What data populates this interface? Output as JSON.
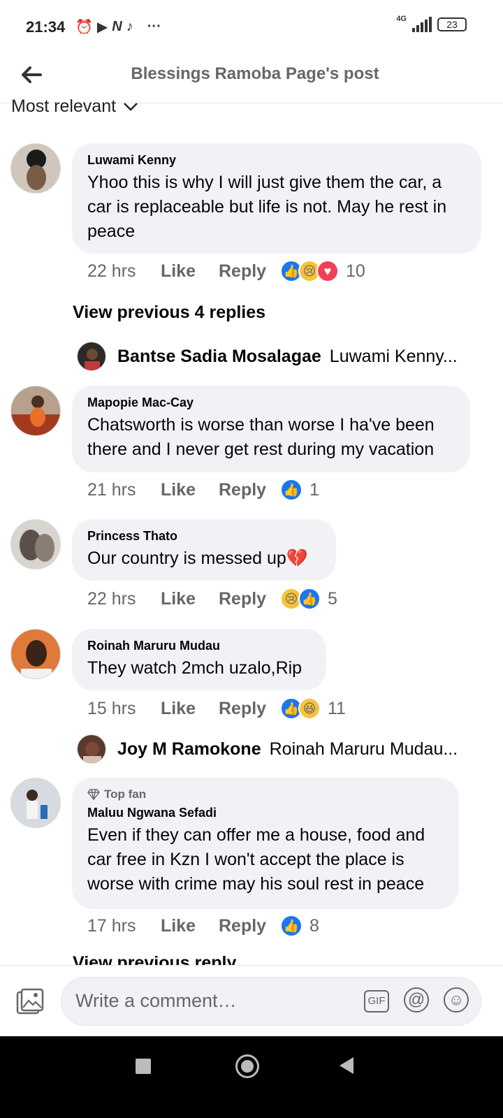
{
  "status_bar": {
    "time": "21:34",
    "network": "4G",
    "battery": "23",
    "more": "···"
  },
  "header": {
    "title": "Blessings Ramoba Page's post"
  },
  "sort": {
    "label": "Most relevant"
  },
  "comments": [
    {
      "name": "Luwami Kenny",
      "text": "Yhoo this is why I will just give them the car, a car is replaceable but life is not. May he rest in peace",
      "time": "22 hrs",
      "like": "Like",
      "reply": "Reply",
      "reactions": [
        "like-icon",
        "sad-icon",
        "love-icon"
      ],
      "count": "10"
    },
    {
      "name": "Mapopie Mac-Cay",
      "text": "Chatsworth is worse than  worse I ha've been there and I never get rest during my vacation",
      "time": "21 hrs",
      "like": "Like",
      "reply": "Reply",
      "reactions": [
        "like-icon"
      ],
      "count": "1"
    },
    {
      "name": "Princess Thato",
      "text": "Our country is messed up💔",
      "time": "22 hrs",
      "like": "Like",
      "reply": "Reply",
      "reactions": [
        "sad-icon",
        "like-icon"
      ],
      "count": "5"
    },
    {
      "name": "Roinah Maruru Mudau",
      "text": "They watch 2mch uzalo,Rip",
      "time": "15 hrs",
      "like": "Like",
      "reply": "Reply",
      "reactions": [
        "like-icon",
        "haha-icon"
      ],
      "count": "11"
    },
    {
      "badge": "Top fan",
      "name": "Maluu Ngwana Sefadi",
      "text": "Even if they can offer me a house, food and car free in Kzn I won't accept the place is worse with crime may his soul rest in peace",
      "time": "17 hrs",
      "like": "Like",
      "reply": "Reply",
      "reactions": [
        "like-icon"
      ],
      "count": "8"
    }
  ],
  "view_previous": "View previous 4 replies",
  "subreplies": [
    {
      "name": "Bantse Sadia Mosalagae",
      "text": "Luwami Kenny..."
    },
    {
      "name": "Joy M Ramokone",
      "text": "Roinah Maruru Mudau..."
    }
  ],
  "partial_link": "View previous reply",
  "composer": {
    "placeholder": "Write a comment…",
    "gif": "GIF",
    "at": "@"
  }
}
